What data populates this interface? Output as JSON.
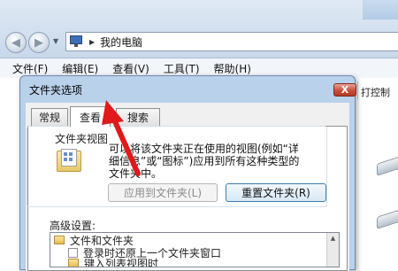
{
  "explorer": {
    "address_path": "我的电脑",
    "menu": [
      "文件(F)",
      "编辑(E)",
      "查看(V)",
      "工具(T)",
      "帮助(H)"
    ],
    "right_toolbar_text": "打控制"
  },
  "dialog": {
    "title": "文件夹选项",
    "close_glyph": "X",
    "tabs": [
      "常规",
      "查看",
      "搜索"
    ],
    "active_tab": "查看",
    "folder_view": {
      "group_title": "文件夹视图",
      "description": "可以将该文件夹正在使用的视图(例如“详细信息”或“图标”)应用到所有这种类型的文件夹中。",
      "apply_button": "应用到文件夹(L)",
      "reset_button": "重置文件夹(R)"
    },
    "advanced": {
      "label": "高级设置:",
      "items": [
        "文件和文件夹",
        "登录时还原上一个文件夹窗口",
        "键入列表视图时"
      ]
    }
  },
  "colors": {
    "annotation_arrow": "#e0191b",
    "dialog_frame": "#b9d1ea",
    "close_button": "#c7503a"
  }
}
